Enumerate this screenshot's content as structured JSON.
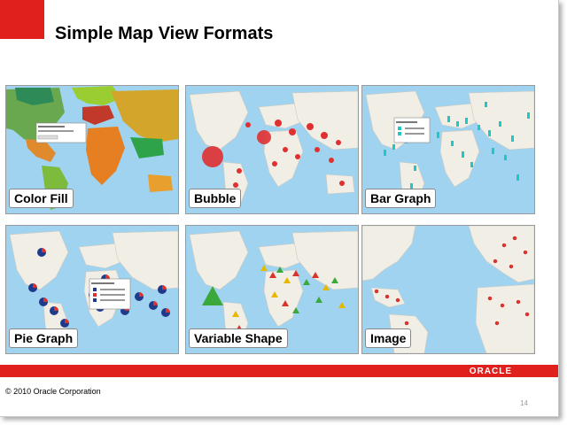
{
  "slide": {
    "title": "Simple Map View Formats",
    "copyright": "© 2010 Oracle Corporation",
    "page_number": "14",
    "logo_text": "ORACLE",
    "colors": {
      "brand_red": "#e0201c",
      "ocean": "#9fd3f0",
      "land": "#f1eee6"
    }
  },
  "tiles": [
    {
      "label": "Color Fill",
      "icon": "color-fill-map"
    },
    {
      "label": "Bubble",
      "icon": "bubble-map"
    },
    {
      "label": "Bar Graph",
      "icon": "bar-graph-map"
    },
    {
      "label": "Pie Graph",
      "icon": "pie-graph-map"
    },
    {
      "label": "Variable Shape",
      "icon": "variable-shape-map"
    },
    {
      "label": "Image",
      "icon": "image-map"
    }
  ]
}
